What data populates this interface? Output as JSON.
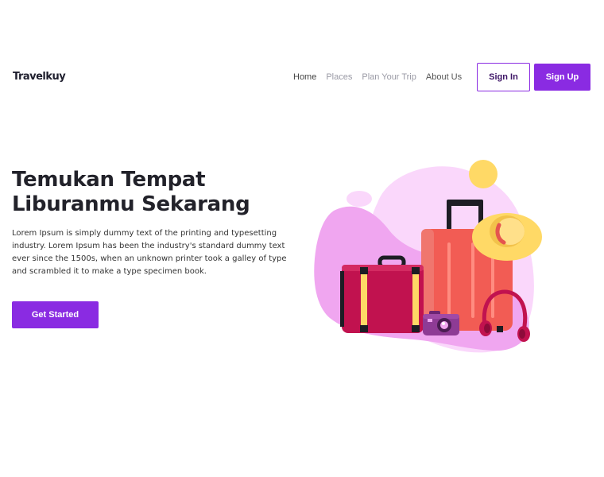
{
  "header": {
    "logo": "Travelkuy",
    "nav": [
      "Home",
      "Places",
      "Plan Your Trip",
      "About Us"
    ],
    "sign_in": "Sign In",
    "sign_up": "Sign Up"
  },
  "hero": {
    "title": "Temukan Tempat Liburanmu Sekarang",
    "description": "Lorem Ipsum is simply dummy text of the printing and typesetting industry. Lorem Ipsum has been the industry's standard dummy text ever since the 1500s, when an unknown printer took a galley of type and scrambled it to make a type specimen book.",
    "cta": "Get Started"
  },
  "colors": {
    "accent": "#8a2be2",
    "blob": "#f0a6f0",
    "suitcase_orange": "#f25c54",
    "suitcase_red": "#c1124f",
    "hat": "#ffd966"
  },
  "illustration_icons": [
    "suitcase-icon",
    "luggage-icon",
    "sun-hat-icon",
    "camera-icon",
    "headphones-icon",
    "sun-icon"
  ]
}
